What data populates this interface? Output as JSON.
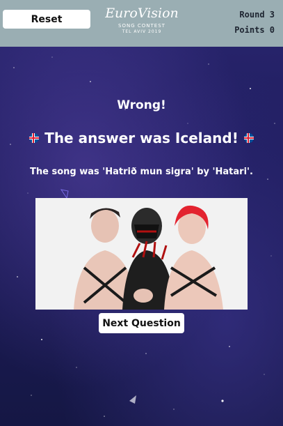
{
  "header": {
    "reset_label": "Reset",
    "logo": {
      "main": "EuroVision",
      "sub": "SONG CONTEST",
      "sub2": "TEL AVIV 2019"
    },
    "round_text": "Round 3",
    "points_text": "Points 0"
  },
  "result": {
    "status": "Wrong!",
    "answer": "The answer was Iceland!",
    "song": "The song was 'Hatrið mun sigra' by 'Hatari'."
  },
  "next_label": "Next Question",
  "colors": {
    "header_bg": "#9aaeb3",
    "page_bg": "#1f1d5e",
    "flag_blue": "#02529c",
    "flag_red": "#dc1e35"
  },
  "icons": [
    "iceland-flag-icon",
    "eurovision-heart-icon"
  ]
}
